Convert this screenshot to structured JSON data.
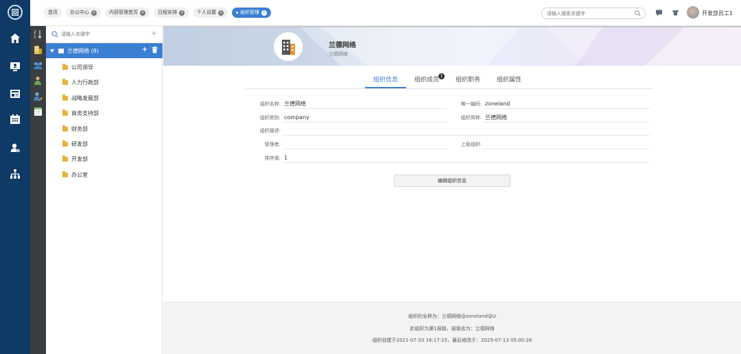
{
  "rail": {
    "logo": "回",
    "icons": [
      "home-icon",
      "monitor-user-icon",
      "news-icon",
      "calendar-icon",
      "user-settings-icon",
      "org-chart-icon"
    ]
  },
  "topbar": {
    "tabs": [
      {
        "label": "首页",
        "closable": false
      },
      {
        "label": "办公中心",
        "closable": true
      },
      {
        "label": "内容管理首页",
        "closable": true
      },
      {
        "label": "日程安排",
        "closable": true
      },
      {
        "label": "个人设置",
        "closable": true
      },
      {
        "label": "组织管理",
        "closable": true,
        "active": true
      }
    ],
    "search_placeholder": "请输入搜索关键字",
    "user_name": "开发部员工1"
  },
  "strip": {
    "icons": [
      "sort-az-icon",
      "building-icon",
      "group-icon",
      "person-icon",
      "user-edit-icon",
      "calendar-doc-icon"
    ]
  },
  "tree": {
    "search_placeholder": "请输入关键字",
    "root": {
      "label": "兰德网络 (8)"
    },
    "children": [
      "公司领导",
      "人力行政部",
      "战略发展部",
      "商务支持部",
      "财务部",
      "研发部",
      "开发部",
      "办公室"
    ]
  },
  "banner": {
    "org_name": "兰德网络",
    "org_sub": "兰德网络"
  },
  "info_tabs": [
    {
      "label": "组织信息",
      "active": true
    },
    {
      "label": "组织成员",
      "badge": "1"
    },
    {
      "label": "组织职务"
    },
    {
      "label": "组织属性"
    }
  ],
  "form": {
    "org_name_label": "组织名称:",
    "org_name": "兰德网络",
    "unique_code_label": "唯一编码:",
    "unique_code": "zoneland",
    "org_type_label": "组织类别:",
    "org_type": "company",
    "short_name_label": "组织简称:",
    "short_name": "兰德网络",
    "desc_label": "组织描述:",
    "desc": "",
    "manager_label": "管理者:",
    "manager": "",
    "parent_label": "上级组织:",
    "parent": "",
    "order_label": "排序值:",
    "order": "1",
    "edit_button": "编辑组织信息"
  },
  "footer": {
    "line1": "组织的全称为：兰德网络@zoneland@U",
    "line2": "此组织为第1层级，层级名为：兰德网络",
    "line3": "组织创建于2021-07-20 16:17:15，最后修改于：2025-07-13 05:00:26"
  }
}
